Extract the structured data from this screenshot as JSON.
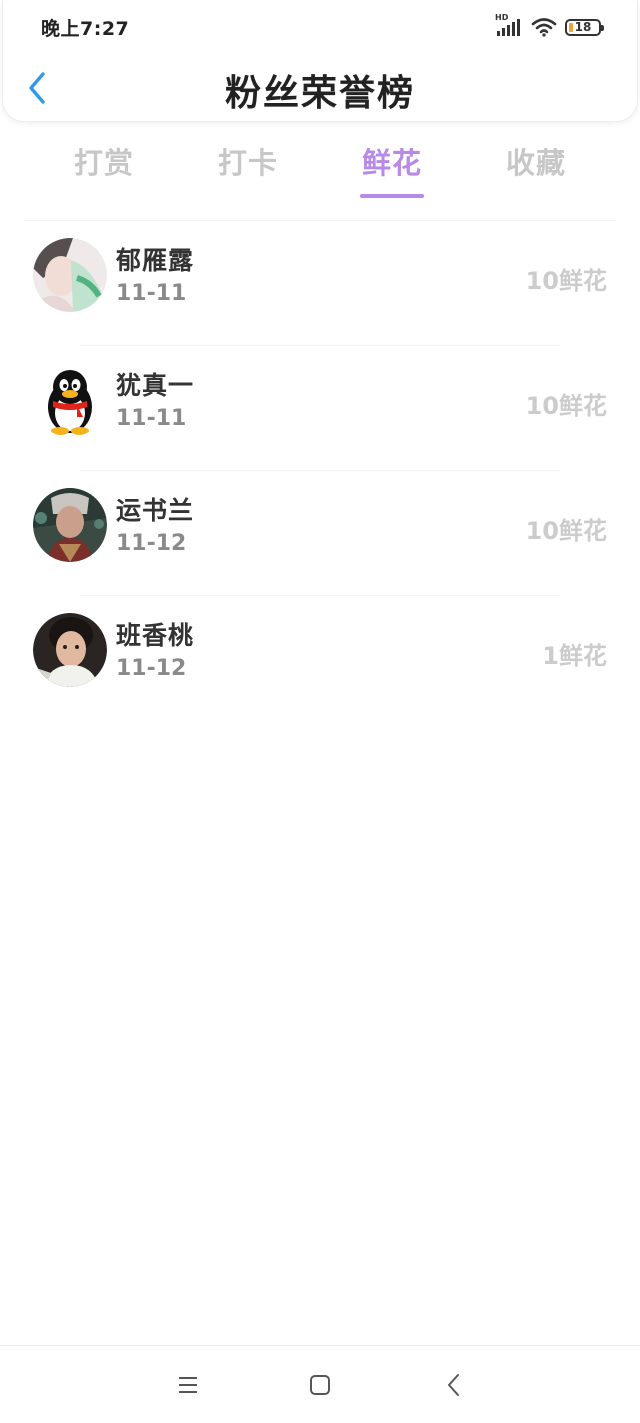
{
  "status_bar": {
    "time": "晚上7:27",
    "network_label": "HD",
    "battery_level": "18",
    "icons": [
      "signal-icon",
      "wifi-icon",
      "battery-icon"
    ]
  },
  "header": {
    "title": "粉丝荣誉榜",
    "back_icon": "chevron-left-icon"
  },
  "tabs": [
    {
      "label": "打赏",
      "active": false
    },
    {
      "label": "打卡",
      "active": false
    },
    {
      "label": "鲜花",
      "active": true
    },
    {
      "label": "收藏",
      "active": false
    }
  ],
  "fans": [
    {
      "name": "郁雁露",
      "date": "11-11",
      "amount": "10鲜花",
      "avatar": "anime-avatar"
    },
    {
      "name": "犹真一",
      "date": "11-11",
      "amount": "10鲜花",
      "avatar": "qq-penguin-avatar"
    },
    {
      "name": "运书兰",
      "date": "11-12",
      "amount": "10鲜花",
      "avatar": "game-character-avatar"
    },
    {
      "name": "班香桃",
      "date": "11-12",
      "amount": "1鲜花",
      "avatar": "child-photo-avatar"
    }
  ],
  "nav_bar": {
    "icons": [
      "menu-icon",
      "home-icon",
      "back-icon"
    ]
  },
  "colors": {
    "accent": "#b68ae6",
    "back_arrow": "#2f9be8",
    "inactive_tab": "#c7c7c7",
    "amount": "#cccccc"
  }
}
